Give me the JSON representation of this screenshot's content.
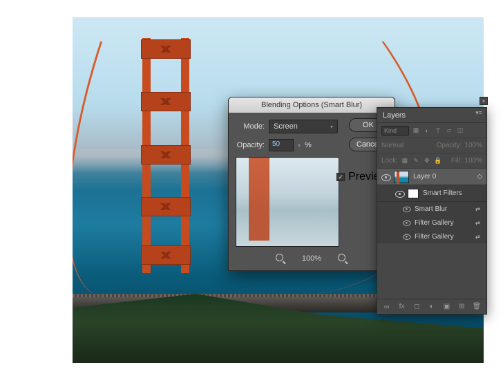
{
  "dialog": {
    "title": "Blending Options (Smart Blur)",
    "mode_label": "Mode:",
    "mode_value": "Screen",
    "opacity_label": "Opacity:",
    "opacity_value": "50",
    "opacity_unit": "%",
    "ok": "OK",
    "cancel": "Cancel",
    "preview": "Preview",
    "zoom": "100%"
  },
  "layers": {
    "title": "Layers",
    "kind_label": "Kind",
    "mode": "Normal",
    "opacity_label": "Opacity:",
    "opacity_value": "100%",
    "lock_label": "Lock:",
    "fill_label": "Fill:",
    "fill_value": "100%",
    "layer0": "Layer 0",
    "smart_filters": "Smart Filters",
    "filters": [
      "Smart Blur",
      "Filter Gallery",
      "Filter Gallery"
    ]
  }
}
